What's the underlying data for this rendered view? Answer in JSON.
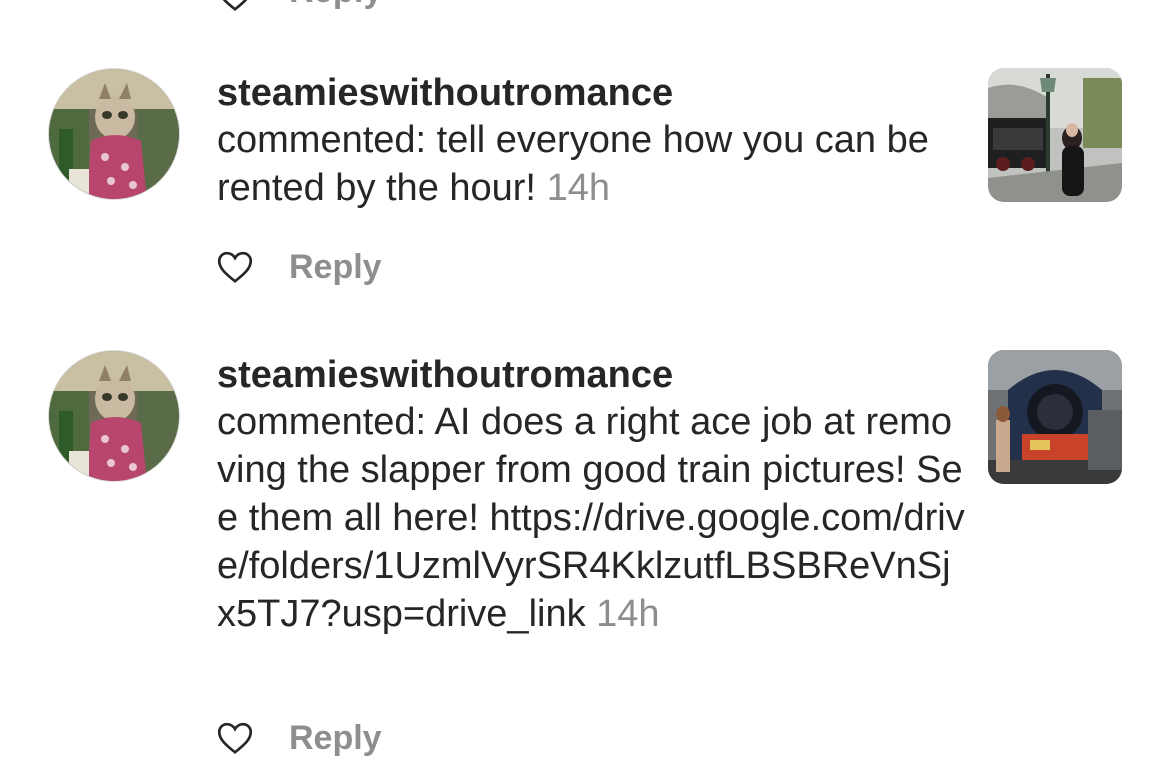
{
  "top_partial": {
    "reply_label": "Reply"
  },
  "notifications": [
    {
      "username": "steamieswithoutromance",
      "comment": "commented: tell everyone how you can be rented by the hour!",
      "time": "14h",
      "reply_label": "Reply",
      "thumb_icon": "train-platform-photo"
    },
    {
      "username": "steamieswithoutromance",
      "comment": "commented: AI does a right ace job at removing the slapper from good train pictures! See them all here!  https://drive.google.com/drive/folders/1UzmlVyrSR4KklzutfLBSBReVnSjx5TJ7?usp=drive_link",
      "time": "14h",
      "reply_label": "Reply",
      "thumb_icon": "locomotive-museum-photo"
    }
  ],
  "colors": {
    "text": "#262626",
    "muted": "#8e8e8e",
    "background": "#ffffff"
  }
}
